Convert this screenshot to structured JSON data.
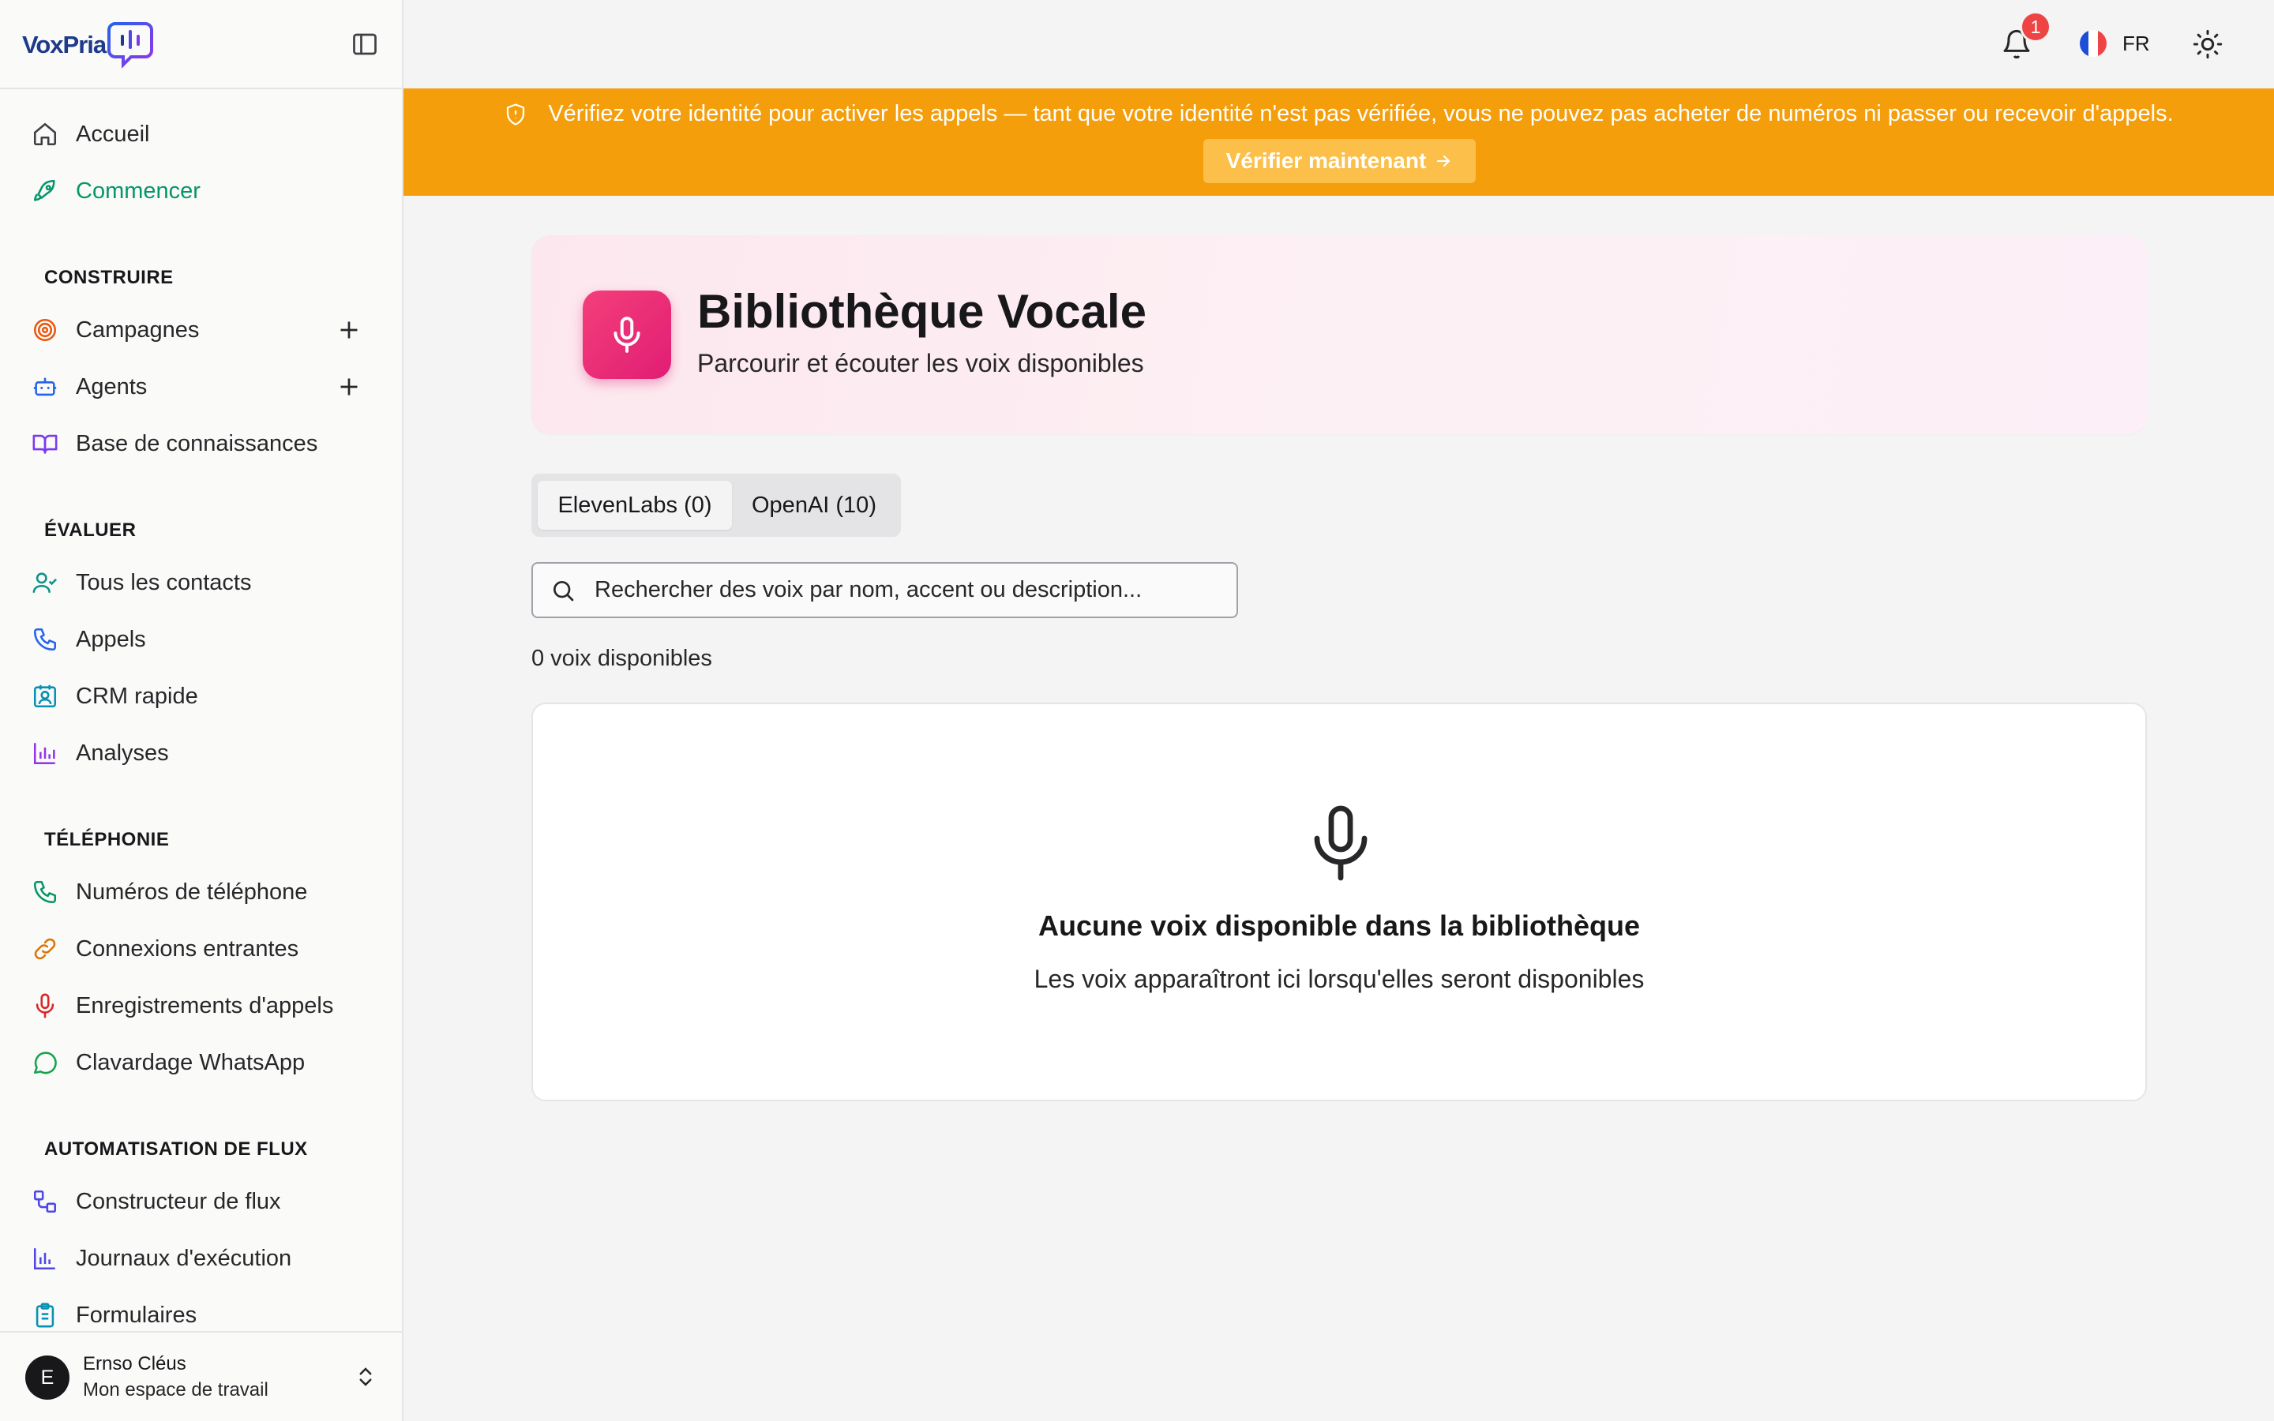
{
  "brand": {
    "name": "VoxPria"
  },
  "sidebar": {
    "items_top": [
      {
        "label": "Accueil",
        "icon": "home-icon"
      },
      {
        "label": "Commencer",
        "icon": "rocket-icon"
      }
    ],
    "sections": [
      {
        "title": "CONSTRUIRE",
        "items": [
          {
            "label": "Campagnes",
            "icon": "target-icon"
          },
          {
            "label": "Agents",
            "icon": "bot-icon"
          },
          {
            "label": "Base de connaissances",
            "icon": "book-icon"
          }
        ]
      },
      {
        "title": "ÉVALUER",
        "items": [
          {
            "label": "Tous les contacts",
            "icon": "user-check-icon"
          },
          {
            "label": "Appels",
            "icon": "phone-icon"
          },
          {
            "label": "CRM rapide",
            "icon": "contact-card-icon"
          },
          {
            "label": "Analyses",
            "icon": "bar-chart-icon"
          }
        ]
      },
      {
        "title": "TÉLÉPHONIE",
        "items": [
          {
            "label": "Numéros de téléphone",
            "icon": "phone-icon"
          },
          {
            "label": "Connexions entrantes",
            "icon": "link-icon"
          },
          {
            "label": "Enregistrements d'appels",
            "icon": "mic-icon"
          },
          {
            "label": "Clavardage WhatsApp",
            "icon": "chat-bubble-icon"
          }
        ]
      },
      {
        "title": "AUTOMATISATION DE FLUX",
        "items": [
          {
            "label": "Constructeur de flux",
            "icon": "workflow-icon"
          },
          {
            "label": "Journaux d'exécution",
            "icon": "bar-chart-icon"
          },
          {
            "label": "Formulaires",
            "icon": "clipboard-icon"
          }
        ]
      }
    ],
    "user": {
      "initial": "E",
      "name": "Ernso Cléus",
      "workspace": "Mon espace de travail"
    }
  },
  "topbar": {
    "notifications_count": "1",
    "language": "FR"
  },
  "banner": {
    "message": "Vérifiez votre identité pour activer les appels — tant que votre identité n'est pas vérifiée, vous ne pouvez pas acheter de numéros ni passer ou recevoir d'appels.",
    "button_label": "Vérifier maintenant",
    "color": "#f59e0b"
  },
  "page": {
    "title": "Bibliothèque Vocale",
    "subtitle": "Parcourir et écouter les voix disponibles",
    "tabs": [
      {
        "label": "ElevenLabs (0)",
        "active": true
      },
      {
        "label": "OpenAI (10)",
        "active": false
      }
    ],
    "search": {
      "placeholder": "Rechercher des voix par nom, accent ou description...",
      "value": ""
    },
    "count_text": "0 voix disponibles",
    "empty": {
      "title": "Aucune voix disponible dans la bibliothèque",
      "subtitle": "Les voix apparaîtront ici lorsqu'elles seront disponibles"
    }
  },
  "colors": {
    "accent_green": "#059669",
    "pink": "#e11d74",
    "warning": "#f59e0b"
  }
}
